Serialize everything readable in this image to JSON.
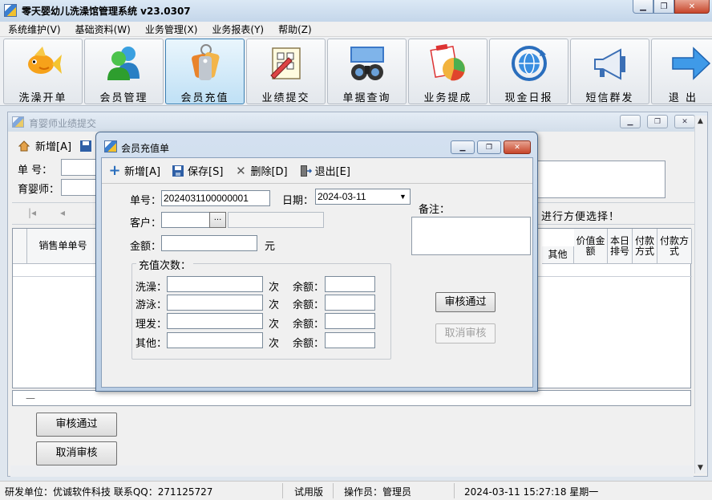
{
  "app": {
    "title": "零天婴幼儿洗澡馆管理系统   v23.0307"
  },
  "window_controls": {
    "minimize": "▁",
    "restore": "❐",
    "close": "✕"
  },
  "menu": [
    "系统维护(V)",
    "基础资料(W)",
    "业务管理(X)",
    "业务报表(Y)",
    "帮助(Z)"
  ],
  "toolbar": [
    {
      "label": "洗澡开单",
      "icon": "goldfish-icon"
    },
    {
      "label": "会员管理",
      "icon": "users-icon"
    },
    {
      "label": "会员充值",
      "icon": "tags-icon",
      "active": true
    },
    {
      "label": "业绩提交",
      "icon": "notepad-icon"
    },
    {
      "label": "单据查询",
      "icon": "binoculars-icon"
    },
    {
      "label": "业务提成",
      "icon": "pie-chart-icon"
    },
    {
      "label": "现金日报",
      "icon": "globe-refresh-icon"
    },
    {
      "label": "短信群发",
      "icon": "megaphone-icon"
    },
    {
      "label": "退  出",
      "icon": "arrow-right-icon"
    }
  ],
  "bg_window": {
    "title": "育婴师业绩提交",
    "toolbar": {
      "new": "新增[A]"
    },
    "fields": {
      "order_no_label": "单    号：",
      "nanny_label": "育婴师："
    },
    "hint": "进行方便选择！",
    "grid_headers": {
      "sales_no": "销售单单号",
      "other": "其他",
      "value_amount": "价值金额",
      "day_no": "本日排号",
      "pay_method": "付款方式",
      "pay_method2": "付款方式"
    },
    "buttons": {
      "approve": "审核通过",
      "cancel_approve": "取消审核"
    }
  },
  "dialog": {
    "title": "会员充值单",
    "toolbar": {
      "new": "新增[A]",
      "save": "保存[S]",
      "delete": "删除[D]",
      "exit": "退出[E]"
    },
    "labels": {
      "order_no": "单号：",
      "date": "日期：",
      "customer": "客户：",
      "amount": "金额：",
      "yuan": "元",
      "note": "备注：",
      "recharge_times": "充值次数：",
      "times_unit": "次",
      "balance": "余额："
    },
    "values": {
      "order_no": "2024031100000001",
      "date": "2024-03-11",
      "customer_button": "..."
    },
    "services": [
      "洗澡：",
      "游泳：",
      "理发：",
      "其他："
    ],
    "buttons": {
      "approve": "审核通过",
      "cancel_approve": "取消审核"
    }
  },
  "statusbar": {
    "developer": "研发单位：优诚软件科技   联系QQ：271125727",
    "edition": "试用版",
    "operator": "操作员：管理员",
    "datetime": "2024-03-11  15:27:18 星期一"
  }
}
